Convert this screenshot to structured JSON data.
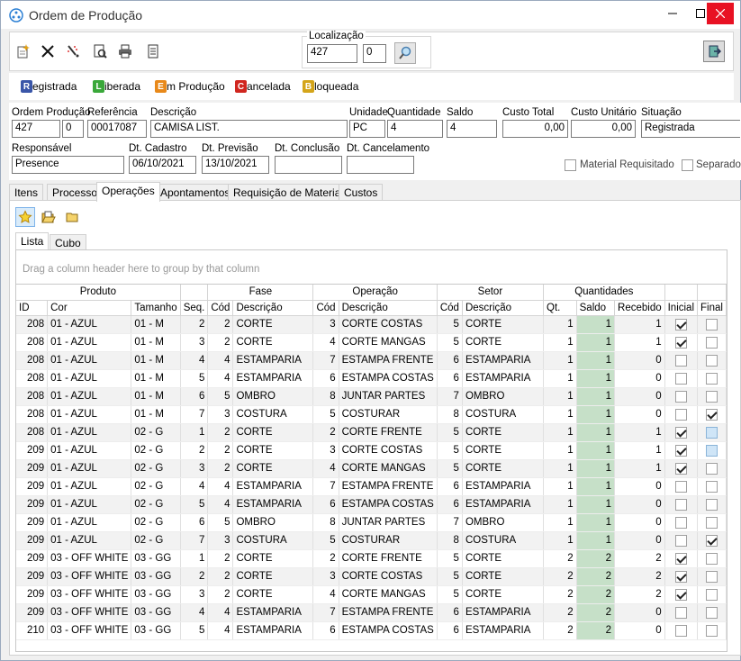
{
  "window": {
    "title": "Ordem de Produção"
  },
  "toolbar": {
    "location_label": "Localização",
    "location_value_1": "427",
    "location_value_2": "0"
  },
  "statuses": [
    {
      "letter": "R",
      "rest": "egistrada",
      "color": "#3a56a8"
    },
    {
      "letter": "L",
      "rest": "iberada",
      "color": "#3aa83a"
    },
    {
      "letter": "E",
      "rest": "m Produção",
      "color": "#e8891a"
    },
    {
      "letter": "C",
      "rest": "ancelada",
      "color": "#d0261f"
    },
    {
      "letter": "B",
      "rest": "loqueada",
      "color": "#d4a51a"
    }
  ],
  "form": {
    "ordem_producao_label": "Ordem Produção",
    "ordem_producao_1": "427",
    "ordem_producao_2": "0",
    "referencia_label": "Referência",
    "referencia": "00017087",
    "descricao_label": "Descrição",
    "descricao": "CAMISA LIST.",
    "unidade_label": "Unidade",
    "unidade": "PC",
    "quantidade_label": "Quantidade",
    "quantidade": "4",
    "saldo_label": "Saldo",
    "saldo": "4",
    "custo_total_label": "Custo Total",
    "custo_total": "0,00",
    "custo_unitario_label": "Custo Unitário",
    "custo_unitario": "0,00",
    "situacao_label": "Situação",
    "situacao": "Registrada",
    "responsavel_label": "Responsável",
    "responsavel": "Presence",
    "dt_cadastro_label": "Dt. Cadastro",
    "dt_cadastro": "06/10/2021",
    "dt_previsao_label": "Dt. Previsão",
    "dt_previsao": "13/10/2021",
    "dt_conclusao_label": "Dt. Conclusão",
    "dt_conclusao": "",
    "dt_cancelamento_label": "Dt. Cancelamento",
    "dt_cancelamento": "",
    "material_requisitado_label": "Material Requisitado",
    "separado_label": "Separado"
  },
  "tabs": [
    "Itens",
    "Processo",
    "Operações",
    "Apontamentos",
    "Requisição de Materiais",
    "Custos"
  ],
  "subtabs": [
    "Lista",
    "Cubo"
  ],
  "grid": {
    "group_hint": "Drag a column header here to group by that column",
    "bands": [
      "Produto",
      "Fase",
      "Operação",
      "Setor",
      "Quantidades"
    ],
    "columns": [
      "ID",
      "Cor",
      "Tamanho",
      "Seq.",
      "Cód",
      "Descrição",
      "Cód",
      "Descrição",
      "Cód",
      "Descrição",
      "Qt.",
      "Saldo",
      "Recebido",
      "Inicial",
      "Final"
    ],
    "rows": [
      {
        "id": "208",
        "cor": "01 - AZUL",
        "tam": "01 - M",
        "seq": "2",
        "fcod": "2",
        "fdesc": "CORTE",
        "ocod": "3",
        "odesc": "CORTE COSTAS",
        "scod": "5",
        "sdesc": "CORTE",
        "qt": "1",
        "saldo": "1",
        "rec": "1",
        "ini": "on",
        "fin": "off"
      },
      {
        "id": "208",
        "cor": "01 - AZUL",
        "tam": "01 - M",
        "seq": "3",
        "fcod": "2",
        "fdesc": "CORTE",
        "ocod": "4",
        "odesc": "CORTE MANGAS",
        "scod": "5",
        "sdesc": "CORTE",
        "qt": "1",
        "saldo": "1",
        "rec": "1",
        "ini": "on",
        "fin": "off"
      },
      {
        "id": "208",
        "cor": "01 - AZUL",
        "tam": "01 - M",
        "seq": "4",
        "fcod": "4",
        "fdesc": "ESTAMPARIA",
        "ocod": "7",
        "odesc": "ESTAMPA FRENTE",
        "scod": "6",
        "sdesc": "ESTAMPARIA",
        "qt": "1",
        "saldo": "1",
        "rec": "0",
        "ini": "off",
        "fin": "off"
      },
      {
        "id": "208",
        "cor": "01 - AZUL",
        "tam": "01 - M",
        "seq": "5",
        "fcod": "4",
        "fdesc": "ESTAMPARIA",
        "ocod": "6",
        "odesc": "ESTAMPA COSTAS",
        "scod": "6",
        "sdesc": "ESTAMPARIA",
        "qt": "1",
        "saldo": "1",
        "rec": "0",
        "ini": "off",
        "fin": "off"
      },
      {
        "id": "208",
        "cor": "01 - AZUL",
        "tam": "01 - M",
        "seq": "6",
        "fcod": "5",
        "fdesc": "OMBRO",
        "ocod": "8",
        "odesc": "JUNTAR PARTES",
        "scod": "7",
        "sdesc": "OMBRO",
        "qt": "1",
        "saldo": "1",
        "rec": "0",
        "ini": "off",
        "fin": "off"
      },
      {
        "id": "208",
        "cor": "01 - AZUL",
        "tam": "01 - M",
        "seq": "7",
        "fcod": "3",
        "fdesc": "COSTURA",
        "ocod": "5",
        "odesc": "COSTURAR",
        "scod": "8",
        "sdesc": "COSTURA",
        "qt": "1",
        "saldo": "1",
        "rec": "0",
        "ini": "off",
        "fin": "on"
      },
      {
        "id": "208",
        "cor": "01 - AZUL",
        "tam": "02 - G",
        "seq": "1",
        "fcod": "2",
        "fdesc": "CORTE",
        "ocod": "2",
        "odesc": "CORTE FRENTE",
        "scod": "5",
        "sdesc": "CORTE",
        "qt": "1",
        "saldo": "1",
        "rec": "1",
        "ini": "on",
        "fin": "blue"
      },
      {
        "id": "209",
        "cor": "01 - AZUL",
        "tam": "02 - G",
        "seq": "2",
        "fcod": "2",
        "fdesc": "CORTE",
        "ocod": "3",
        "odesc": "CORTE COSTAS",
        "scod": "5",
        "sdesc": "CORTE",
        "qt": "1",
        "saldo": "1",
        "rec": "1",
        "ini": "on",
        "fin": "blue"
      },
      {
        "id": "209",
        "cor": "01 - AZUL",
        "tam": "02 - G",
        "seq": "3",
        "fcod": "2",
        "fdesc": "CORTE",
        "ocod": "4",
        "odesc": "CORTE MANGAS",
        "scod": "5",
        "sdesc": "CORTE",
        "qt": "1",
        "saldo": "1",
        "rec": "1",
        "ini": "on",
        "fin": "off"
      },
      {
        "id": "209",
        "cor": "01 - AZUL",
        "tam": "02 - G",
        "seq": "4",
        "fcod": "4",
        "fdesc": "ESTAMPARIA",
        "ocod": "7",
        "odesc": "ESTAMPA FRENTE",
        "scod": "6",
        "sdesc": "ESTAMPARIA",
        "qt": "1",
        "saldo": "1",
        "rec": "0",
        "ini": "off",
        "fin": "off"
      },
      {
        "id": "209",
        "cor": "01 - AZUL",
        "tam": "02 - G",
        "seq": "5",
        "fcod": "4",
        "fdesc": "ESTAMPARIA",
        "ocod": "6",
        "odesc": "ESTAMPA COSTAS",
        "scod": "6",
        "sdesc": "ESTAMPARIA",
        "qt": "1",
        "saldo": "1",
        "rec": "0",
        "ini": "off",
        "fin": "off"
      },
      {
        "id": "209",
        "cor": "01 - AZUL",
        "tam": "02 - G",
        "seq": "6",
        "fcod": "5",
        "fdesc": "OMBRO",
        "ocod": "8",
        "odesc": "JUNTAR PARTES",
        "scod": "7",
        "sdesc": "OMBRO",
        "qt": "1",
        "saldo": "1",
        "rec": "0",
        "ini": "off",
        "fin": "off"
      },
      {
        "id": "209",
        "cor": "01 - AZUL",
        "tam": "02 - G",
        "seq": "7",
        "fcod": "3",
        "fdesc": "COSTURA",
        "ocod": "5",
        "odesc": "COSTURAR",
        "scod": "8",
        "sdesc": "COSTURA",
        "qt": "1",
        "saldo": "1",
        "rec": "0",
        "ini": "off",
        "fin": "on"
      },
      {
        "id": "209",
        "cor": "03 - OFF WHITE",
        "tam": "03 - GG",
        "seq": "1",
        "fcod": "2",
        "fdesc": "CORTE",
        "ocod": "2",
        "odesc": "CORTE FRENTE",
        "scod": "5",
        "sdesc": "CORTE",
        "qt": "2",
        "saldo": "2",
        "rec": "2",
        "ini": "on",
        "fin": "off"
      },
      {
        "id": "209",
        "cor": "03 - OFF WHITE",
        "tam": "03 - GG",
        "seq": "2",
        "fcod": "2",
        "fdesc": "CORTE",
        "ocod": "3",
        "odesc": "CORTE COSTAS",
        "scod": "5",
        "sdesc": "CORTE",
        "qt": "2",
        "saldo": "2",
        "rec": "2",
        "ini": "on",
        "fin": "off"
      },
      {
        "id": "209",
        "cor": "03 - OFF WHITE",
        "tam": "03 - GG",
        "seq": "3",
        "fcod": "2",
        "fdesc": "CORTE",
        "ocod": "4",
        "odesc": "CORTE MANGAS",
        "scod": "5",
        "sdesc": "CORTE",
        "qt": "2",
        "saldo": "2",
        "rec": "2",
        "ini": "on",
        "fin": "off"
      },
      {
        "id": "209",
        "cor": "03 - OFF WHITE",
        "tam": "03 - GG",
        "seq": "4",
        "fcod": "4",
        "fdesc": "ESTAMPARIA",
        "ocod": "7",
        "odesc": "ESTAMPA FRENTE",
        "scod": "6",
        "sdesc": "ESTAMPARIA",
        "qt": "2",
        "saldo": "2",
        "rec": "0",
        "ini": "off",
        "fin": "off"
      },
      {
        "id": "210",
        "cor": "03 - OFF WHITE",
        "tam": "03 - GG",
        "seq": "5",
        "fcod": "4",
        "fdesc": "ESTAMPARIA",
        "ocod": "6",
        "odesc": "ESTAMPA COSTAS",
        "scod": "6",
        "sdesc": "ESTAMPARIA",
        "qt": "2",
        "saldo": "2",
        "rec": "0",
        "ini": "off",
        "fin": "off"
      }
    ]
  },
  "colors": {
    "saldo_bg": "#c6e0c8",
    "close_btn": "#e81123"
  }
}
